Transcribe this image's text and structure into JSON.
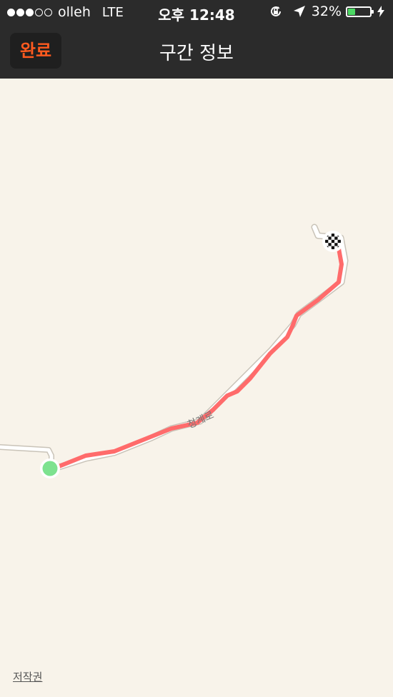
{
  "status_bar": {
    "carrier": "olleh",
    "network": "LTE",
    "time": "오후 12:48",
    "battery_percent": "32%",
    "battery_level": 0.32,
    "signal_bars_filled": 3,
    "signal_bars_total": 5
  },
  "nav": {
    "done_label": "완료",
    "title": "구간 정보"
  },
  "map": {
    "road_label": "청계로",
    "copyright": "저작권",
    "route_color": "#ff6b6b",
    "start_marker_color": "#7de28f"
  },
  "colors": {
    "accent": "#ff5a1f",
    "bar_background": "#2b2b2b",
    "map_background": "#f8f3ea"
  }
}
